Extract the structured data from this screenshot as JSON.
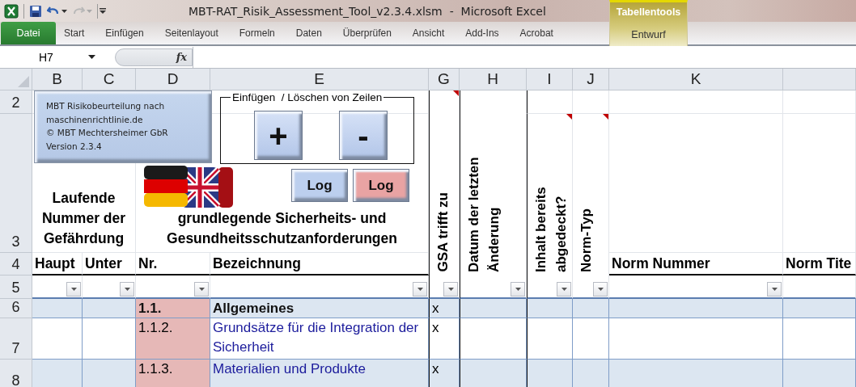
{
  "window": {
    "title": "MBT-RAT_Risik_Assessment_Tool_v2.3.4.xlsm  -  Microsoft Excel"
  },
  "ribbon": {
    "file_tab": "Datei",
    "tabs": [
      {
        "label": "Start",
        "selected": false
      },
      {
        "label": "Einfügen",
        "selected": false
      },
      {
        "label": "Seitenlayout",
        "selected": false
      },
      {
        "label": "Formeln",
        "selected": false
      },
      {
        "label": "Daten",
        "selected": false
      },
      {
        "label": "Überprüfen",
        "selected": false
      },
      {
        "label": "Ansicht",
        "selected": false
      },
      {
        "label": "Add-Ins",
        "selected": false
      },
      {
        "label": "Acrobat",
        "selected": false
      }
    ],
    "context_group": {
      "title": "Tabellentools",
      "tabs": [
        {
          "label": "Entwurf",
          "selected": false
        }
      ]
    }
  },
  "formula_bar": {
    "name_box": "H7",
    "fx": "fx"
  },
  "columns": [
    {
      "letter": "B",
      "filter": true
    },
    {
      "letter": "C",
      "filter": true
    },
    {
      "letter": "D",
      "filter": true
    },
    {
      "letter": "E",
      "filter": true
    },
    {
      "letter": "G",
      "filter": true
    },
    {
      "letter": "H",
      "filter": true
    },
    {
      "letter": "I",
      "filter": true
    },
    {
      "letter": "J",
      "filter": true
    },
    {
      "letter": "K",
      "filter": true
    }
  ],
  "row_numbers": [
    "2",
    "3",
    "4",
    "5",
    "6",
    "7",
    "8"
  ],
  "info_box": "MBT Risikobeurteilung nach\nmaschinenrichtlinie.de\n© MBT Mechtersheimer GbR\nVersion 2.3.4",
  "row_group": {
    "title": "Einfügen  / Löschen von Zeilen",
    "buttons": [
      "+",
      "-"
    ]
  },
  "log_buttons": [
    {
      "label": "Log",
      "color": "#bccfee"
    },
    {
      "label": "Log",
      "color": "#e9a3a3"
    }
  ],
  "group_headers": [
    "Laufende Nummer der Gefährdung",
    "grundlegende Sicherheits- und Gesundheitsschutzanforderungen"
  ],
  "vertical_headers": [
    {
      "text": "GSA trifft zu",
      "comment": true
    },
    {
      "text": "Datum der letzten Änderung",
      "comment": false
    },
    {
      "text": "Inhalt bereits abgedeckt?",
      "comment": true
    },
    {
      "text": "Norm-Typ",
      "comment": true
    }
  ],
  "column_headers": [
    "Haupt",
    "Unter",
    "Nr.",
    "Bezeichnung",
    "Norm Nummer",
    "Norm Tite"
  ],
  "rows": [
    {
      "kind": "heading",
      "nr": "1.1.",
      "name": "Allgemeines",
      "gsa": "x"
    },
    {
      "kind": "item",
      "nr": "1.1.2.",
      "name": "Grundsätze für die Integration der Sicherheit",
      "gsa": "x"
    },
    {
      "kind": "item",
      "nr": "1.1.3.",
      "name": "Materialien und Produkte",
      "gsa": "x"
    }
  ]
}
